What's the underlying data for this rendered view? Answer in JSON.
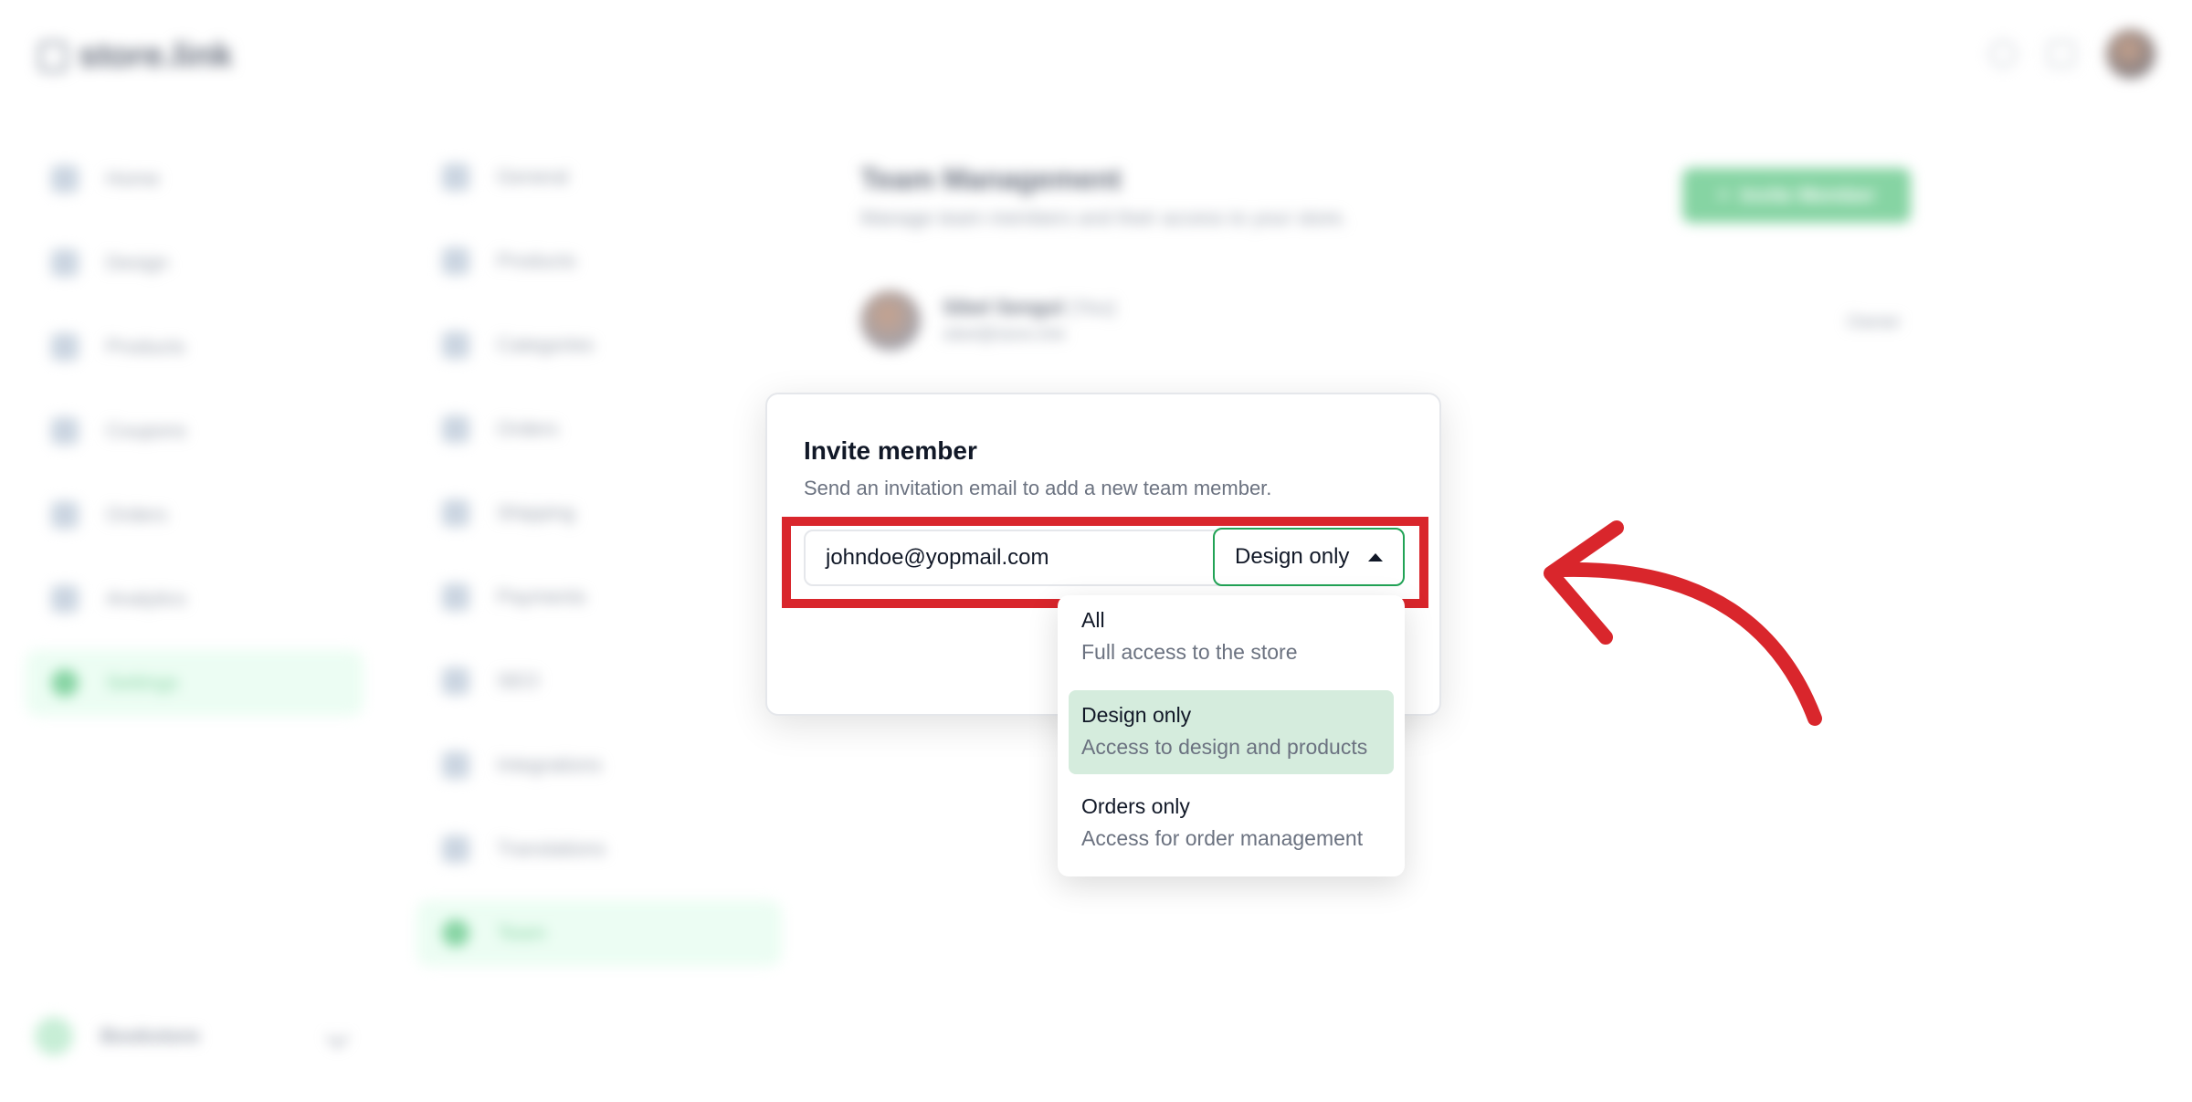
{
  "app": {
    "logo_text": "store.link"
  },
  "main_nav": [
    {
      "label": "Home",
      "icon": "home-icon"
    },
    {
      "label": "Design",
      "icon": "design-icon"
    },
    {
      "label": "Products",
      "icon": "box-icon"
    },
    {
      "label": "Coupons",
      "icon": "tag-icon"
    },
    {
      "label": "Orders",
      "icon": "cart-icon"
    },
    {
      "label": "Analytics",
      "icon": "chart-icon"
    },
    {
      "label": "Settings",
      "icon": "gear-icon"
    }
  ],
  "settings_nav": [
    {
      "label": "General",
      "icon": "monitor-icon"
    },
    {
      "label": "Products",
      "icon": "calendar-icon"
    },
    {
      "label": "Categories",
      "icon": "shapes-icon"
    },
    {
      "label": "Orders",
      "icon": "list-icon"
    },
    {
      "label": "Shipping",
      "icon": "truck-icon"
    },
    {
      "label": "Payments",
      "icon": "card-icon"
    },
    {
      "label": "SEO",
      "icon": "globe-icon"
    },
    {
      "label": "Integrations",
      "icon": "link-icon"
    },
    {
      "label": "Translations",
      "icon": "translate-icon"
    },
    {
      "label": "Team",
      "icon": "team-icon"
    }
  ],
  "store_switcher": {
    "name": "Bookstore"
  },
  "team": {
    "title": "Team Management",
    "subtitle": "Manage team members and their access to your store.",
    "invite_button": "Invite Member",
    "member": {
      "name": "Sibel Sengul",
      "you": "(You)",
      "email": "sibel@store.link",
      "role": "Owner"
    }
  },
  "modal": {
    "title": "Invite member",
    "subtitle": "Send an invitation email to add a new team member.",
    "email_value": "johndoe@yopmail.com",
    "role_selected": "Design only",
    "options": [
      {
        "label": "All",
        "description": "Full access to the store"
      },
      {
        "label": "Design only",
        "description": "Access to design and products"
      },
      {
        "label": "Orders only",
        "description": "Access for order management"
      }
    ]
  },
  "colors": {
    "accent": "#22a356",
    "highlight": "#d9262c",
    "selected_bg": "#d5ecdd"
  }
}
